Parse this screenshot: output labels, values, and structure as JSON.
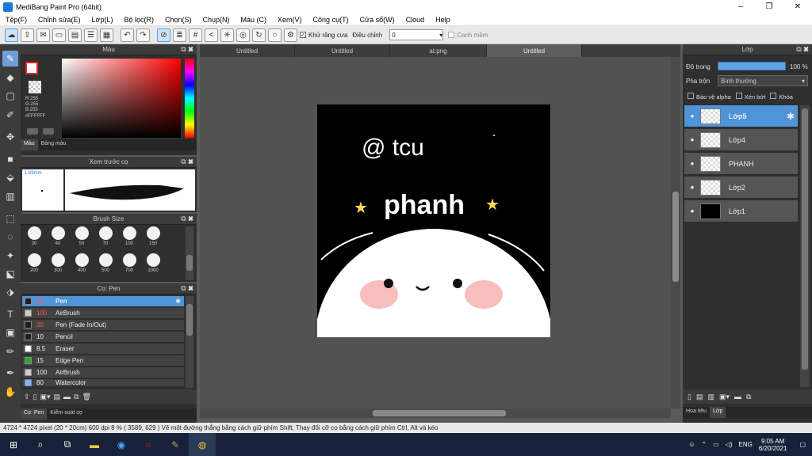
{
  "window": {
    "title": "MediBang Paint Pro (64bit)",
    "controls": [
      "–",
      "❐",
      "✕"
    ]
  },
  "menu": [
    "Tệp(F)",
    "Chỉnh sửa(E)",
    "Lớp(L)",
    "Bộ lọc(R)",
    "Chọn(S)",
    "Chụp(N)",
    "Màu (C)",
    "Xem(V)",
    "Công cụ(T)",
    "Cửa sổ(W)",
    "Cloud",
    "Help"
  ],
  "toolbar": {
    "antialias_label": "Khử răng cưa",
    "adjust_label": "Điều chỉnh",
    "adjust_value": "0",
    "snap_label": "Canh mềm"
  },
  "color_panel": {
    "title": "Màu",
    "rgb": "R:255\nG:255\nB:255",
    "hex": "#FFFFFF",
    "tabs": [
      "Màu",
      "Bảng màu"
    ]
  },
  "brush_preview": {
    "title": "Xem trước cọ",
    "size": "1.69mm"
  },
  "brush_size": {
    "title": "Brush Size",
    "sizes": [
      "30",
      "40",
      "50",
      "70",
      "100",
      "150",
      "200",
      "300",
      "400",
      "500",
      "700",
      "1000"
    ]
  },
  "brush_panel": {
    "title": "Cọ: Pen",
    "items": [
      {
        "size": "40",
        "name": "Pen",
        "color": "#1e1e1e",
        "active": true
      },
      {
        "size": "100",
        "name": "AirBrush",
        "color": "#cccccc",
        "active": false
      },
      {
        "size": "30",
        "name": "Pen (Fade In/Out)",
        "color": "#1e1e1e",
        "active": false
      },
      {
        "size": "10",
        "name": "Pencil",
        "color": "#1e1e1e",
        "active": false
      },
      {
        "size": "8.5",
        "name": "Eraser",
        "color": "#ffffff",
        "active": false
      },
      {
        "size": "15",
        "name": "Edge Pen",
        "color": "#22aa22",
        "active": false
      },
      {
        "size": "100",
        "name": "AirBrush",
        "color": "#cccccc",
        "active": false
      },
      {
        "size": "80",
        "name": "Watercolor",
        "color": "#7fb7ff",
        "active": false
      }
    ],
    "bottom_tabs": [
      "Cọ: Pen",
      "Kiểm soát cọ"
    ]
  },
  "doc_tabs": [
    "Untitled",
    "Untitled",
    "at.png",
    "Untitled"
  ],
  "artwork": {
    "handle": "@ tcu",
    "name": "phanh"
  },
  "layer_panel": {
    "title": "Lớp",
    "opacity_label": "Độ trong",
    "opacity_value": "100 %",
    "blend_label": "Pha trộn",
    "blend_value": "Bình thường",
    "checks": [
      "Bảo vệ alpha",
      "Xén bớt",
      "Khóa"
    ],
    "layers": [
      {
        "name": "Lớp5",
        "active": true
      },
      {
        "name": "Lớp4",
        "active": false
      },
      {
        "name": "PHANH",
        "active": false
      },
      {
        "name": "Lớp2",
        "active": false
      },
      {
        "name": "Lớp1",
        "active": false
      }
    ],
    "bottom_tabs": [
      "Hoa tiêu",
      "Lớp"
    ]
  },
  "status": "4724 * 4724 pixel  (20 * 20cm)  600 dpi  8 %  ( 3589, 629 )  Vẽ một đường thẳng bằng cách giữ phím Shift, Thay đổi cỡ cọ bằng cách giữ phím Ctrl, Alt và kéo",
  "taskbar": {
    "lang": "ENG",
    "time": "9:05 AM",
    "date": "6/20/2021"
  }
}
